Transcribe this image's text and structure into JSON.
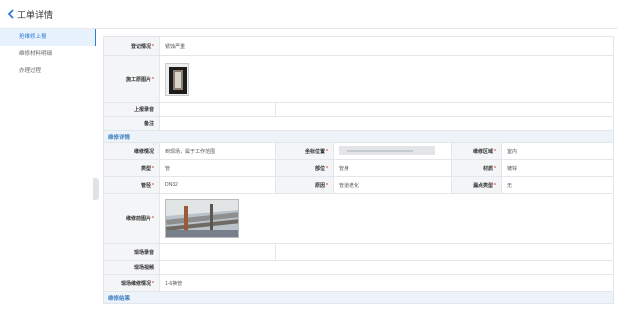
{
  "header": {
    "title": "工单详情"
  },
  "sidebar": {
    "items": [
      {
        "label": "抢维修上报",
        "active": true
      },
      {
        "label": "维修材料明细",
        "active": false
      },
      {
        "label": "办理过程",
        "active": false
      }
    ]
  },
  "report": {
    "register": {
      "label": "登记情况",
      "value": "锈蚀严重"
    },
    "photo": {
      "label": "施工原图片"
    },
    "audio": {
      "label": "上报录音",
      "value": ""
    },
    "note": {
      "label": "备注",
      "value": ""
    }
  },
  "repair": {
    "section": "维修详情",
    "status": {
      "label": "维修情况",
      "value": "到现场，属于工作范围"
    },
    "location": {
      "label": "坐标位置"
    },
    "area": {
      "label": "维修区域",
      "value": "室内"
    },
    "category": {
      "label": "类型",
      "value": "管"
    },
    "part": {
      "label": "部位",
      "value": "管身"
    },
    "material": {
      "label": "材质",
      "value": "镀锌"
    },
    "diameter": {
      "label": "管径",
      "value": "DN32"
    },
    "reason": {
      "label": "原因",
      "value": "管道老化"
    },
    "leak": {
      "label": "漏点类型",
      "value": "无"
    },
    "photo": {
      "label": "维修前图片"
    },
    "audio": {
      "label": "现场录音",
      "value": ""
    },
    "video": {
      "label": "现场视频",
      "value": ""
    },
    "site": {
      "label": "现场维修情况",
      "value": "1-6换管"
    }
  },
  "result": {
    "section": "维修结果"
  },
  "colors": {
    "accent": "#2f7bd8",
    "required": "#e5463b",
    "section_text": "#3f7fc4"
  },
  "icons": {
    "back": "chevron-left-icon"
  }
}
